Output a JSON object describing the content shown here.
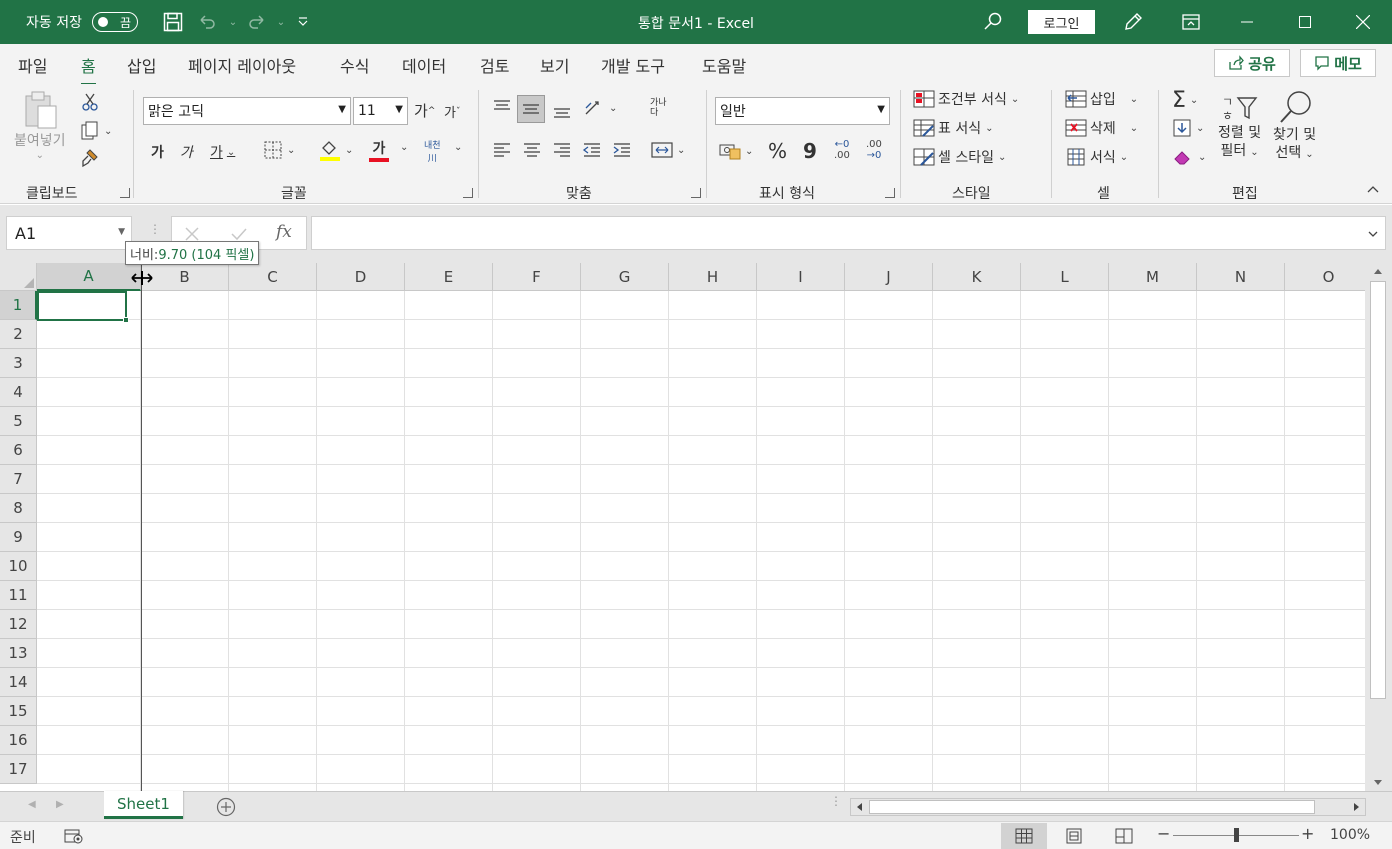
{
  "titlebar": {
    "autosave_label": "자동 저장",
    "autosave_state": "끔",
    "document_title": "통합 문서1  -  Excel",
    "login_label": "로그인"
  },
  "ribbon_tabs": [
    "파일",
    "홈",
    "삽입",
    "페이지 레이아웃",
    "수식",
    "데이터",
    "검토",
    "보기",
    "개발 도구",
    "도움말"
  ],
  "active_tab": "홈",
  "share_label": "공유",
  "memo_label": "메모",
  "clipboard": {
    "paste_label": "붙여넣기",
    "group_label": "클립보드"
  },
  "font": {
    "font_name": "맑은 고딕",
    "font_size": "11",
    "grow_label": "가",
    "shrink_label": "가",
    "bold_label": "가",
    "italic_label": "가",
    "underline_label": "가",
    "font_color_label": "가",
    "phonetic_label": "내천",
    "group_label": "글꼴"
  },
  "alignment": {
    "wrap_label": "가나다",
    "group_label": "맞춤"
  },
  "number": {
    "format": "일반",
    "percent": "%",
    "comma": "9",
    "increase_decimal": ".00",
    "decrease_decimal": ".00",
    "group_label": "표시 형식"
  },
  "styles": {
    "conditional": "조건부 서식",
    "as_table": "표 서식",
    "cell_styles": "셀 스타일",
    "group_label": "스타일"
  },
  "cells": {
    "insert": "삽입",
    "delete": "삭제",
    "format": "서식",
    "group_label": "셀"
  },
  "editing": {
    "sort_line1": "정렬 및",
    "sort_line2": "필터",
    "find_line1": "찾기 및",
    "find_line2": "선택",
    "group_label": "편집"
  },
  "formula_bar": {
    "name_box": "A1",
    "fx": "fx",
    "formula": ""
  },
  "tooltip": {
    "label": "너비: ",
    "value": "9.70 (104 픽셀)"
  },
  "columns": [
    "A",
    "B",
    "C",
    "D",
    "E",
    "F",
    "G",
    "H",
    "I",
    "J",
    "K",
    "L",
    "M",
    "N",
    "O"
  ],
  "rows": [
    "1",
    "2",
    "3",
    "4",
    "5",
    "6",
    "7",
    "8",
    "9",
    "10",
    "11",
    "12",
    "13",
    "14",
    "15",
    "16",
    "17"
  ],
  "selected_cell": "A1",
  "sheet_tab": "Sheet1",
  "status": {
    "ready": "준비",
    "zoom": "100%",
    "zoom_level": 1.0
  },
  "colors": {
    "brand": "#217346",
    "ribbon_bg": "#f3f3f3",
    "header_bg": "#e6e6e6",
    "font_color_bar": "#e81123",
    "highlight_bar": "#ffff00"
  }
}
